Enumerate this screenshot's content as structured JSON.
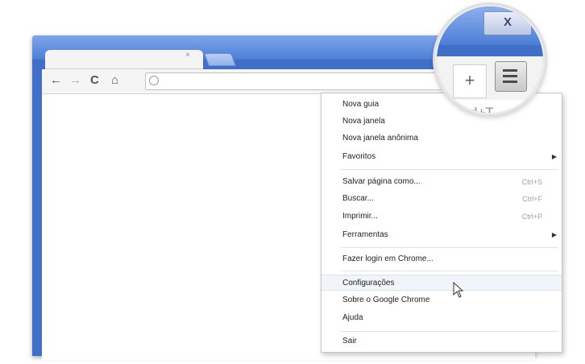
{
  "browser": {
    "tab_close": "×",
    "nav": {
      "back": "←",
      "forward": "→",
      "reload": "C",
      "home": "⌂"
    }
  },
  "menu": {
    "items": [
      {
        "label": "Nova guia",
        "shortcut": ""
      },
      {
        "label": "Nova janela",
        "shortcut": ""
      },
      {
        "label": "Nova janela anônima",
        "shortcut": ""
      },
      {
        "label": "Favoritos",
        "shortcut": "",
        "submenu": true
      },
      {
        "label": "Salvar página como...",
        "shortcut": "Ctrl+S"
      },
      {
        "label": "Buscar...",
        "shortcut": "Ctrl+F"
      },
      {
        "label": "Imprimir...",
        "shortcut": "Ctrl+P"
      },
      {
        "label": "Ferramentas",
        "shortcut": "",
        "submenu": true
      },
      {
        "label": "Fazer login em Chrome...",
        "shortcut": ""
      },
      {
        "label": "Configurações",
        "shortcut": "",
        "highlighted": true
      },
      {
        "label": "Sobre o Google Chrome",
        "shortcut": ""
      },
      {
        "label": "Ajuda",
        "shortcut": ""
      },
      {
        "label": "Sair",
        "shortcut": ""
      }
    ]
  },
  "zoom": {
    "close_label": "X",
    "plus_label": "+",
    "shortcut_label": "Ctrl+T",
    "partial_label": "N"
  },
  "icons": {
    "menu": "hamburger-menu-icon",
    "site_info": "page-info-icon",
    "cursor": "mouse-pointer-icon"
  },
  "colors": {
    "window_frame": "#3f6fc6",
    "menu_highlight": "#f0f4fb"
  }
}
